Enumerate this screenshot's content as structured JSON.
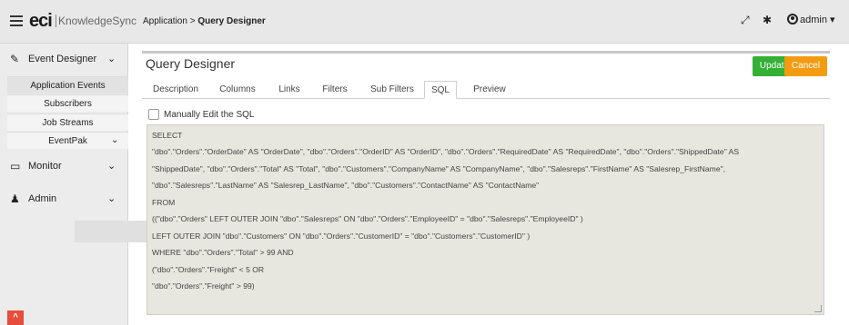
{
  "topbar": {
    "logo_eci": "eci",
    "logo_product": "KnowledgeSync",
    "breadcrumb_parent": "Application",
    "breadcrumb_sep": ">",
    "breadcrumb_current": "Query Designer",
    "expand_glyph": "⤢",
    "settings_glyph": "✱",
    "admin_label": "admin",
    "admin_chevron": "▾"
  },
  "sidebar": {
    "event_designer": {
      "label": "Event Designer",
      "icon": "edit-icon",
      "glyph": "✎",
      "chevron": "⌄"
    },
    "items": [
      {
        "label": "Application Events"
      },
      {
        "label": "Subscribers"
      },
      {
        "label": "Job Streams"
      },
      {
        "label": "EventPak",
        "chevron": "⌄"
      }
    ],
    "monitor": {
      "label": "Monitor",
      "icon": "monitor-icon",
      "glyph": "▭",
      "chevron": "⌄"
    },
    "admin": {
      "label": "Admin",
      "icon": "user-icon",
      "glyph": "♟",
      "chevron": "⌄"
    },
    "scroll_top_glyph": "^"
  },
  "main": {
    "title": "Query Designer",
    "update_label": "Update",
    "cancel_label": "Cancel",
    "tabs": [
      {
        "label": "Description"
      },
      {
        "label": "Columns"
      },
      {
        "label": "Links"
      },
      {
        "label": "Filters"
      },
      {
        "label": "Sub Filters"
      },
      {
        "label": "SQL"
      },
      {
        "label": "Preview"
      }
    ],
    "active_tab": "SQL",
    "manual_edit_label": "Manually Edit the SQL",
    "manual_edit_checked": false,
    "sql_lines": [
      "SELECT",
      "\"dbo\".\"Orders\".\"OrderDate\" AS \"OrderDate\", \"dbo\".\"Orders\".\"OrderID\" AS \"OrderID\", \"dbo\".\"Orders\".\"RequiredDate\" AS \"RequiredDate\", \"dbo\".\"Orders\".\"ShippedDate\" AS",
      "\"ShippedDate\", \"dbo\".\"Orders\".\"Total\" AS \"Total\", \"dbo\".\"Customers\".\"CompanyName\" AS \"CompanyName\", \"dbo\".\"Salesreps\".\"FirstName\" AS \"Salesrep_FirstName\",",
      "\"dbo\".\"Salesreps\".\"LastName\" AS \"Salesrep_LastName\", \"dbo\".\"Customers\".\"ContactName\" AS \"ContactName\"",
      " FROM",
      "((\"dbo\".\"Orders\" LEFT OUTER JOIN \"dbo\".\"Salesreps\" ON \"dbo\".\"Orders\".\"EmployeeID\" = \"dbo\".\"Salesreps\".\"EmployeeID\" )",
      "   LEFT OUTER JOIN \"dbo\".\"Customers\" ON \"dbo\".\"Orders\".\"CustomerID\" = \"dbo\".\"Customers\".\"CustomerID\" )",
      " WHERE \"dbo\".\"Orders\".\"Total\"  > 99 AND",
      "(\"dbo\".\"Orders\".\"Freight\"  < 5 OR",
      "\"dbo\".\"Orders\".\"Freight\"  > 99)"
    ]
  },
  "colors": {
    "update": "#33b035",
    "cancel": "#f39c12",
    "sql_bg": "#e7e7df",
    "scroll_top": "#e74c3c"
  }
}
